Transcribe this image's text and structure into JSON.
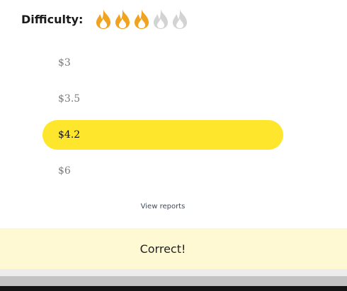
{
  "difficulty": {
    "label": "Difficulty:",
    "rating": 3,
    "max_rating": 5,
    "active_color": "#f0a321",
    "inactive_color": "#d3d3d3",
    "icon": "flame-icon"
  },
  "options": [
    {
      "label": "$3",
      "selected": false
    },
    {
      "label": "$3.5",
      "selected": false
    },
    {
      "label": "$4.2",
      "selected": true
    },
    {
      "label": "$6",
      "selected": false
    }
  ],
  "selected_color": "#fde62b",
  "view_reports_label": "View reports",
  "result": {
    "text": "Correct!",
    "background": "#fef8d3"
  }
}
